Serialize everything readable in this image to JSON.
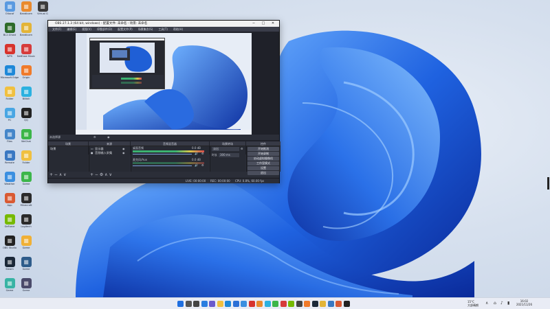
{
  "desktop": {
    "icons": [
      {
        "label": "Oliocaf",
        "icon": "recycle-icon",
        "color": "#5a9ae0"
      },
      {
        "label": "Bandicam",
        "icon": "app-icon",
        "color": "#e98a2e"
      },
      {
        "label": "Virtual G",
        "icon": "logitech-icon",
        "color": "#3b3b3b"
      },
      {
        "label": "BL2.Ghost",
        "icon": "app-icon",
        "color": "#2e6b2a"
      },
      {
        "label": "Bandicam",
        "icon": "owl-icon",
        "color": "#e3b437"
      },
      {
        "label": "WPS",
        "icon": "wps-icon",
        "color": "#d7332d"
      },
      {
        "label": "NetEase Music",
        "icon": "music-icon",
        "color": "#d63b3b"
      },
      {
        "label": "Microsoft Edge",
        "icon": "edge-icon",
        "color": "#1e88d8"
      },
      {
        "label": "Origin",
        "icon": "origin-icon",
        "color": "#f07a2a"
      },
      {
        "label": "Folder",
        "icon": "folder-icon",
        "color": "#f0c040"
      },
      {
        "label": "Bilibili",
        "icon": "bilibili-icon",
        "color": "#2bb1e0"
      },
      {
        "label": "PC",
        "icon": "pc-icon",
        "color": "#49a6e3"
      },
      {
        "label": "QQ",
        "icon": "qq-icon",
        "color": "#222"
      },
      {
        "label": "Files",
        "icon": "files-icon",
        "color": "#4586c9"
      },
      {
        "label": "WeChat",
        "icon": "wechat-icon",
        "color": "#3cb648"
      },
      {
        "label": "Remote",
        "icon": "remote-icon",
        "color": "#3a78c2"
      },
      {
        "label": "Folder",
        "icon": "folder-icon",
        "color": "#f0c040"
      },
      {
        "label": "Weather",
        "icon": "weather-icon",
        "color": "#3b8fe0"
      },
      {
        "label": "Game",
        "icon": "game-icon",
        "color": "#3cb64a"
      },
      {
        "label": "App",
        "icon": "app-icon",
        "color": "#d95a33"
      },
      {
        "label": "Minecraft",
        "icon": "minecraft-icon",
        "color": "#2a2a2a"
      },
      {
        "label": "GeForce",
        "icon": "nvidia-icon",
        "color": "#76b900"
      },
      {
        "label": "Logitech",
        "icon": "logitech-icon",
        "color": "#2a2a2a"
      },
      {
        "label": "OBS Studio",
        "icon": "obs-icon",
        "color": "#222"
      },
      {
        "label": "Game",
        "icon": "app-icon",
        "color": "#f0b035"
      },
      {
        "label": "Steam",
        "icon": "steam-icon",
        "color": "#1b2838"
      },
      {
        "label": "Game",
        "icon": "app-icon",
        "color": "#2e5c8a"
      },
      {
        "label": "Game",
        "icon": "app-icon",
        "color": "#37b3a4"
      },
      {
        "label": "Game",
        "icon": "app-icon",
        "color": "#4a4a6a"
      }
    ]
  },
  "obs": {
    "title": "OBS 27.1.3 (64 bit, windows) - 配置文件: 未命名 - 场景: 未命名",
    "menu": [
      "文件(F)",
      "编辑(E)",
      "视图(V)",
      "停靠部件(D)",
      "配置文件(P)",
      "场景集合(S)",
      "工具(T)",
      "帮助(H)"
    ],
    "source_notice": "未选择源",
    "docks": {
      "scenes": {
        "header": "场景",
        "items": [
          "场景"
        ]
      },
      "sources": {
        "header": "来源",
        "items": [
          "显示器",
          "音频输入采集"
        ]
      },
      "mixer": {
        "header": "音频混音器",
        "channels": [
          {
            "name": "桌面音频",
            "level": "0.0 dB"
          },
          {
            "name": "麦克风/Aux",
            "level": "0.0 dB"
          }
        ]
      },
      "transitions": {
        "header": "场景转场",
        "type": "淡出",
        "duration_label": "时长",
        "duration": "300 ms"
      },
      "controls": {
        "header": "控件",
        "buttons": [
          "开始推流",
          "开始录制",
          "启动虚拟摄像机",
          "工作室模式",
          "设置",
          "退出"
        ]
      }
    },
    "status": [
      "LIVE: 00:00:00",
      "REC: 00:00:00",
      "CPU: 0.8%, 60.00 fps"
    ]
  },
  "taskbar": {
    "temperature": "15°C",
    "weather": "大部晴朗",
    "time": "16:02",
    "date": "2021/11/26",
    "icons": [
      "windows-start-icon",
      "search-icon",
      "task-view-icon",
      "widgets-icon",
      "chat-icon",
      "explorer-icon",
      "edge-icon",
      "store-icon",
      "mail-icon",
      "app-icon",
      "app-icon",
      "app-icon",
      "app-icon",
      "app-icon",
      "app-icon",
      "app-icon",
      "app-icon",
      "app-icon",
      "app-icon",
      "app-icon",
      "app-icon",
      "app-icon"
    ]
  },
  "colors": {
    "accent": "#1f6fe0",
    "obs_bg": "#2b2e38"
  }
}
